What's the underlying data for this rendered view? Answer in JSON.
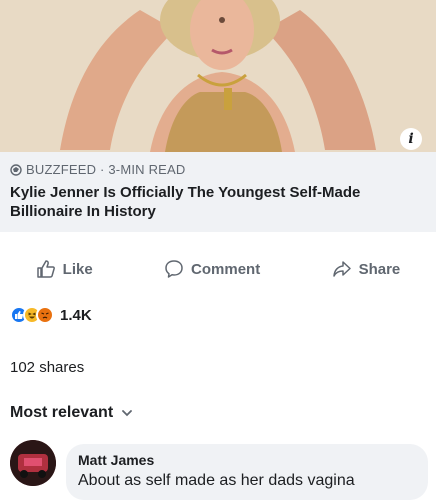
{
  "post": {
    "link_source": "BUZZFEED · 3-MIN READ",
    "headline": "Kylie Jenner Is Officially The Youngest Self-Made Billionaire In History",
    "info_glyph": "i"
  },
  "actions": {
    "like_label": "Like",
    "comment_label": "Comment",
    "share_label": "Share"
  },
  "engagement": {
    "reaction_count": "1.4K",
    "reaction_icons": [
      "like-icon",
      "haha-icon",
      "angry-icon"
    ],
    "shares_text": "102 shares"
  },
  "comments": {
    "sort_label": "Most relevant",
    "items": [
      {
        "author": "Matt James",
        "text": "About as self made as her dads vagina"
      }
    ]
  },
  "colors": {
    "like_blue": "#1877f2",
    "haha_yellow": "#f7b928",
    "angry_orange": "#e9710f",
    "secondary_text": "#606770",
    "card_bg": "#f0f2f5"
  }
}
